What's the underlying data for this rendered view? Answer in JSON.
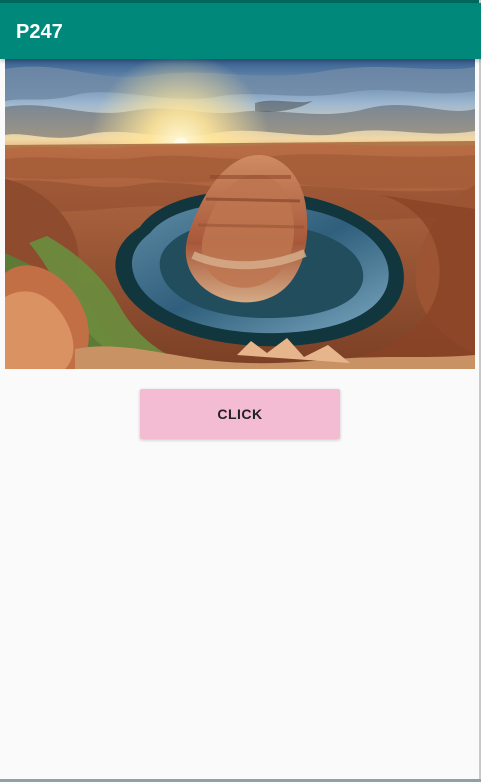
{
  "app_bar": {
    "title": "P247"
  },
  "main": {
    "image_subject": "canyon-river-bend-landscape",
    "button_label": "CLICK"
  },
  "colors": {
    "app_bar": "#00897b",
    "status_strip": "#00695c",
    "button": "#f3bcd3",
    "background": "#fafafa"
  }
}
